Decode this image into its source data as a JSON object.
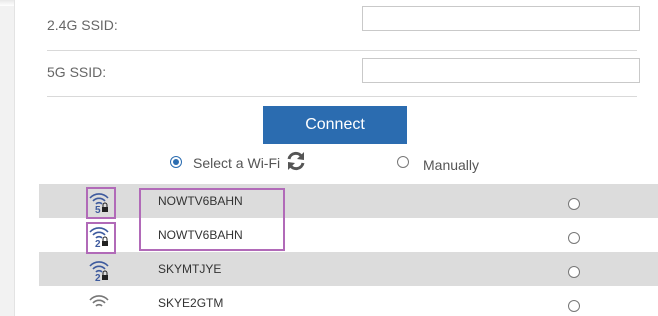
{
  "form": {
    "ssid24_label": "2.4G SSID:",
    "ssid24_value": "",
    "ssid5_label": "5G SSID:",
    "ssid5_value": ""
  },
  "connect_label": "Connect",
  "mode": {
    "select_label": "Select a Wi-Fi",
    "manual_label": "Manually",
    "selected": "select"
  },
  "networks": [
    {
      "band": "5",
      "secured": true,
      "ssid": "NOWTV6BAHN",
      "selected": false
    },
    {
      "band": "2",
      "secured": true,
      "ssid": "NOWTV6BAHN",
      "selected": false
    },
    {
      "band": "2",
      "secured": true,
      "ssid": "SKYMTJYE",
      "selected": false
    },
    {
      "band": "",
      "secured": false,
      "ssid": "SKYE2GTM",
      "selected": false
    }
  ],
  "colors": {
    "accent": "#2b6cb0",
    "highlight": "#b16ab8",
    "row_shaded": "#dcdcdc"
  },
  "icons": {
    "refresh": "refresh-icon",
    "signal": "wifi-signal-icon",
    "lock": "lock-icon"
  }
}
